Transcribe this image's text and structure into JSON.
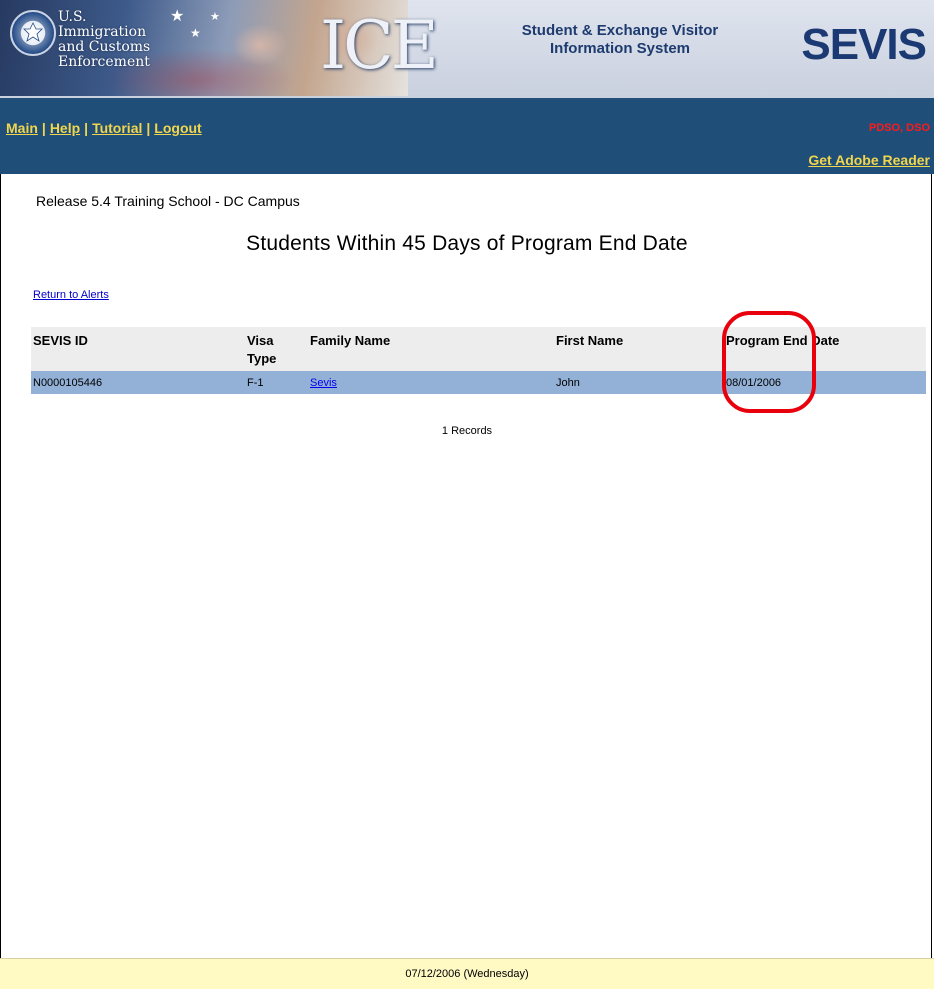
{
  "banner": {
    "agency_name": "U.S. Immigration\nand Customs\nEnforcement",
    "ice_logo": "ICE",
    "system_title": "Student & Exchange Visitor\nInformation System",
    "sevis_logo": "SEVIS"
  },
  "nav": {
    "links": [
      {
        "label": "Main"
      },
      {
        "label": "Help"
      },
      {
        "label": "Tutorial"
      },
      {
        "label": "Logout"
      }
    ],
    "separator": "|",
    "role": "PDSO, DSO",
    "adobe_link": "Get Adobe Reader"
  },
  "page": {
    "school_name": "Release 5.4 Training School - DC Campus",
    "title": "Students Within 45 Days of Program End Date",
    "return_link": "Return to Alerts",
    "records_count": "1 Records"
  },
  "table": {
    "headers": {
      "sevis_id": "SEVIS ID",
      "visa_type": "Visa Type",
      "family_name": "Family Name",
      "first_name": "First Name",
      "program_end_date": "Program End Date"
    },
    "rows": [
      {
        "sevis_id": "N0000105446",
        "visa_type": "F-1",
        "family_name": "Sevis",
        "first_name": "John",
        "program_end_date": "08/01/2006"
      }
    ]
  },
  "footer": {
    "date": "07/12/2006 (Wednesday)"
  },
  "colors": {
    "navbar": "#1f4e78",
    "nav_link": "#f1d64d",
    "role": "#ff1a1a",
    "row_highlight": "#93b1d6",
    "footer_bg": "#fff9c4",
    "annotation_ring": "#e8000d"
  },
  "icons": {
    "seal": "dhs-seal-icon",
    "stars": "star-icon"
  }
}
